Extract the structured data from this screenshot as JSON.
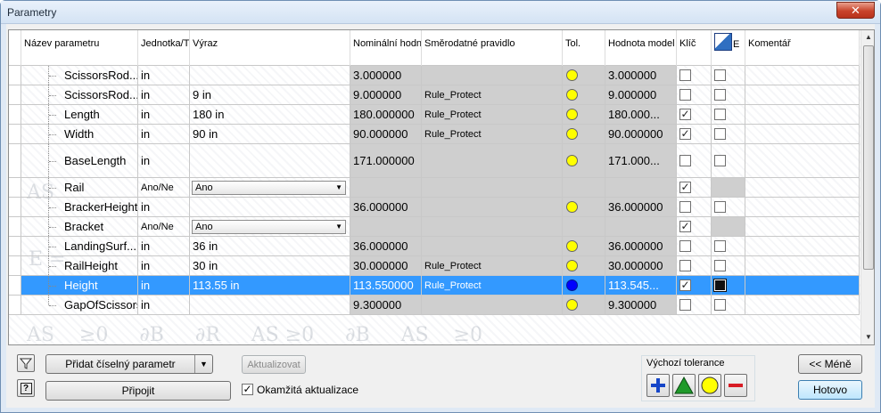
{
  "window": {
    "title": "Parametry",
    "close_icon": "close-icon"
  },
  "columns": [
    "Název parametru",
    "Jednotka/T",
    "Výraz",
    "Nominální hodn",
    "Směrodatné pravidlo",
    "Tol.",
    "Hodnota model",
    "Klíč",
    "E",
    "Komentář"
  ],
  "rows": [
    {
      "name": "ScissorsRod...",
      "unit": "in",
      "expr": "",
      "nominal": "3.000000",
      "rule": "",
      "tol": "yellow",
      "model": "3.000000",
      "key": false,
      "export": false
    },
    {
      "name": "ScissorsRod...",
      "unit": "in",
      "expr": "9 in",
      "nominal": "9.000000",
      "rule": "Rule_Protect",
      "tol": "yellow",
      "model": "9.000000",
      "key": false,
      "export": false
    },
    {
      "name": "Length",
      "unit": "in",
      "expr": "180 in",
      "nominal": "180.000000",
      "rule": "Rule_Protect",
      "tol": "yellow",
      "model": "180.000...",
      "key": true,
      "export": false
    },
    {
      "name": "Width",
      "unit": "in",
      "expr": "90 in",
      "nominal": "90.000000",
      "rule": "Rule_Protect",
      "tol": "yellow",
      "model": "90.000000",
      "key": true,
      "export": false
    },
    {
      "name": "BaseLength",
      "unit": "in",
      "expr": "",
      "nominal": "171.000000",
      "rule": "",
      "tol": "yellow",
      "model": "171.000...",
      "key": false,
      "export": false
    },
    {
      "name": "Rail",
      "unit": "Ano/Ne",
      "expr": "Ano",
      "combo": true,
      "nominal": "",
      "rule": "",
      "tol": "",
      "model": "",
      "key": true,
      "export": null
    },
    {
      "name": "BrackerHeight",
      "unit": "in",
      "expr": "",
      "nominal": "36.000000",
      "rule": "",
      "tol": "yellow",
      "model": "36.000000",
      "key": false,
      "export": false
    },
    {
      "name": "Bracket",
      "unit": "Ano/Ne",
      "expr": "Ano",
      "combo": true,
      "nominal": "",
      "rule": "",
      "tol": "",
      "model": "",
      "key": true,
      "export": null
    },
    {
      "name": "LandingSurf...",
      "unit": "in",
      "expr": "36 in",
      "nominal": "36.000000",
      "rule": "",
      "tol": "yellow",
      "model": "36.000000",
      "key": false,
      "export": false
    },
    {
      "name": "RailHeight",
      "unit": "in",
      "expr": "30 in",
      "nominal": "30.000000",
      "rule": "Rule_Protect",
      "tol": "yellow",
      "model": "30.000000",
      "key": false,
      "export": false
    },
    {
      "name": "Height",
      "unit": "in",
      "expr": "113.55 in",
      "nominal": "113.550000",
      "rule": "Rule_Protect",
      "tol": "blue",
      "model": "113.545...",
      "key": true,
      "export": true,
      "selected": true
    },
    {
      "name": "GapOfScissors",
      "unit": "in",
      "expr": "",
      "nominal": "9.300000",
      "rule": "",
      "tol": "yellow",
      "model": "9.300000",
      "key": false,
      "export": false
    }
  ],
  "buttons": {
    "add_numeric": "Přidat číselný parametr",
    "update": "Aktualizovat",
    "link": "Připojit",
    "less": "<< Méně",
    "done": "Hotovo"
  },
  "immediate_update": {
    "label": "Okamžitá aktualizace",
    "checked": true
  },
  "tolerance": {
    "label": "Výchozí tolerance",
    "options": [
      "plus-icon",
      "triangle-icon",
      "circle-icon",
      "minus-icon"
    ]
  },
  "colors": {
    "selection": "#3399ff",
    "readonly": "#cfcfcf",
    "tol_yellow": "#ffff00",
    "tol_blue": "#0000ff"
  }
}
